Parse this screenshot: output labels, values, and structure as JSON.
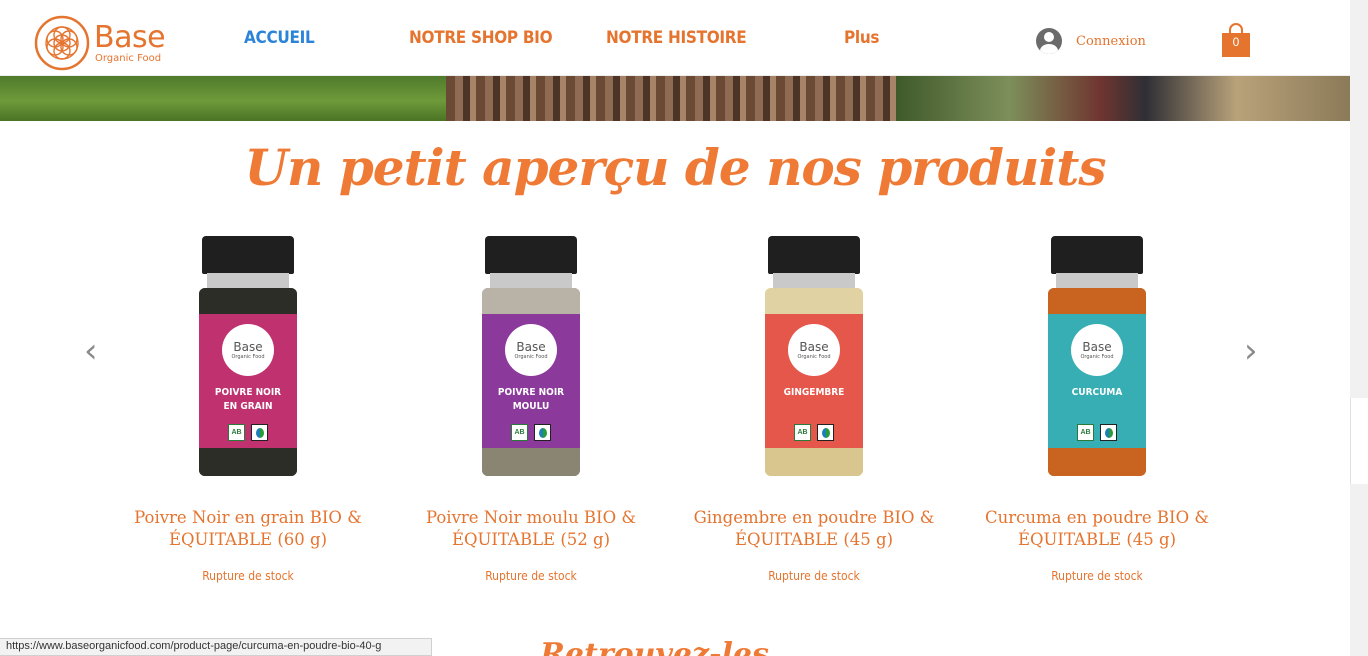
{
  "header": {
    "logo": {
      "name": "Base",
      "subtitle": "Organic Food"
    },
    "nav": [
      {
        "label": "ACCUEIL",
        "active": true
      },
      {
        "label": "NOTRE SHOP BIO",
        "active": false
      },
      {
        "label": "NOTRE HISTOIRE",
        "active": false
      },
      {
        "label": "Plus",
        "active": false
      }
    ],
    "login_label": "Connexion",
    "cart_count": "0"
  },
  "main": {
    "title": "Un petit aperçu de nos produits",
    "carousel": {
      "prev_icon": "chevron-left-icon",
      "next_icon": "chevron-right-icon",
      "products": [
        {
          "name_line1": "Poivre Noir en grain BIO &",
          "name_line2": "ÉQUITABLE (60 g)",
          "stock": "Rupture de stock",
          "jar_text_line1": "POIVRE NOIR",
          "jar_text_line2": "EN GRAIN",
          "label_color": "#c0326f",
          "fill_color": "#2d2d28",
          "weight": "60g"
        },
        {
          "name_line1": "Poivre Noir moulu BIO &",
          "name_line2": "ÉQUITABLE (52 g)",
          "stock": "Rupture de stock",
          "jar_text_line1": "POIVRE NOIR",
          "jar_text_line2": "MOULU",
          "label_color": "#8b3a9b",
          "fill_color": "#8a8473",
          "weight": "52g"
        },
        {
          "name_line1": "Gingembre en poudre BIO &",
          "name_line2": "ÉQUITABLE (45 g)",
          "stock": "Rupture de stock",
          "jar_text_line1": "GINGEMBRE",
          "jar_text_line2": "",
          "label_color": "#e5574a",
          "fill_color": "#d9c58e",
          "weight": "45g"
        },
        {
          "name_line1": "Curcuma en poudre BIO &",
          "name_line2": "ÉQUITABLE (45 g)",
          "stock": "Rupture de stock",
          "jar_text_line1": "CURCUMA",
          "jar_text_line2": "",
          "label_color": "#37aeb3",
          "fill_color": "#c8641f",
          "weight": "45g"
        }
      ]
    }
  },
  "status_bar": {
    "url": "https://www.baseorganicfood.com/product-page/curcuma-en-poudre-bio-40-g"
  },
  "colors": {
    "accent": "#e5742f",
    "active_nav": "#2b84d8",
    "title": "#ee7a35"
  }
}
